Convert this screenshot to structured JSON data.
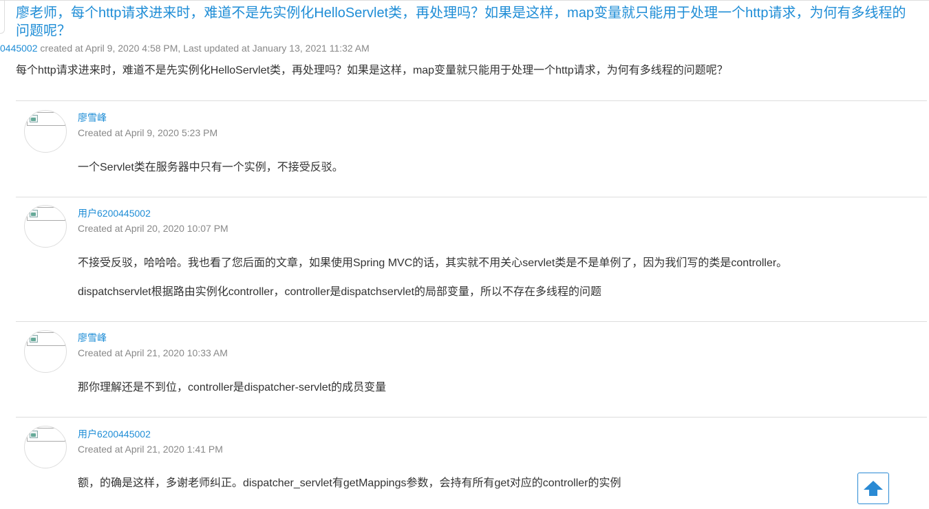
{
  "topic": {
    "title": "廖老师，每个http请求进来时，难道不是先实例化HelloServlet类，再处理吗？如果是这样，map变量就只能用于处理一个http请求，为何有多线程的问题呢？",
    "author_fragment": "0445002",
    "meta": " created at April 9, 2020 4:58 PM, Last updated at January 13, 2021 11:32 AM",
    "body": "每个http请求进来时，难道不是先实例化HelloServlet类，再处理吗？如果是这样，map变量就只能用于处理一个http请求，为何有多线程的问题呢？"
  },
  "replies": [
    {
      "author": "廖雪峰",
      "created": "Created at April 9, 2020 5:23 PM",
      "paragraphs": [
        "一个Servlet类在服务器中只有一个实例，不接受反驳。"
      ]
    },
    {
      "author": "用户6200445002",
      "created": "Created at April 20, 2020 10:07 PM",
      "paragraphs": [
        "不接受反驳，哈哈哈。我也看了您后面的文章，如果使用Spring MVC的话，其实就不用关心servlet类是不是单例了，因为我们写的类是controller。",
        "dispatchservlet根据路由实例化controller，controller是dispatchservlet的局部变量，所以不存在多线程的问题"
      ]
    },
    {
      "author": "廖雪峰",
      "created": "Created at April 21, 2020 10:33 AM",
      "paragraphs": [
        "那你理解还是不到位，controller是dispatcher-servlet的成员变量"
      ]
    },
    {
      "author": "用户6200445002",
      "created": "Created at April 21, 2020 1:41 PM",
      "paragraphs": [
        "额，的确是这样，多谢老师纠正。dispatcher_servlet有getMappings参数，会持有所有get对应的controller的实例"
      ]
    }
  ],
  "icons": {
    "scroll_top": "arrow-up-icon",
    "avatar": "broken-image-icon"
  },
  "colors": {
    "link": "#1f8dd6",
    "text": "#333333",
    "meta": "#888888",
    "divider": "#dddddd",
    "arrow": "#2a8ad4"
  }
}
